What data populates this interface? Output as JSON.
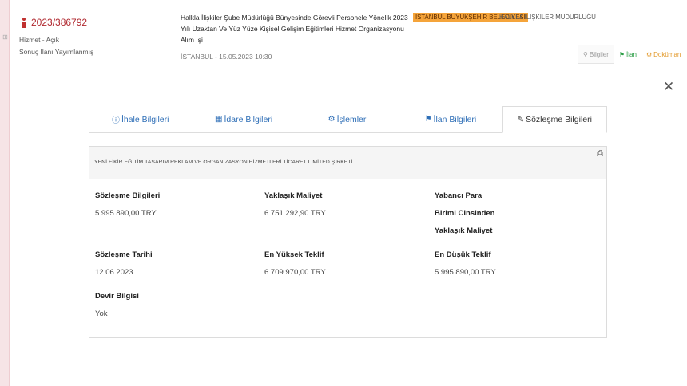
{
  "tender": {
    "number": "2023/386792",
    "status_type": "Hizmet - Açık",
    "status_result": "Sonuç İlanı Yayımlanmış",
    "title": "Halkla İlişkiler Şube Müdürlüğü Bünyesinde Görevli Personele Yönelik 2023 Yılı Uzaktan Ve Yüz Yüze Kişisel Gelişim Eğitimleri Hizmet Organizasyonu Alım İşi",
    "institution": "İSTANBUL BÜYÜKŞEHİR BELEDİYESİ",
    "department": "HALKLA İLİŞKİLER MÜDÜRLÜĞÜ",
    "place_date": "İSTANBUL - 15.05.2023 10:30"
  },
  "top_links": {
    "info": "Bilgiler",
    "announcement": "İlan",
    "document": "Doküman"
  },
  "tabs": [
    {
      "label": "İhale Bilgileri",
      "icon": "info-icon"
    },
    {
      "label": "İdare Bilgileri",
      "icon": "building-icon"
    },
    {
      "label": "İşlemler",
      "icon": "cogs-icon"
    },
    {
      "label": "İlan Bilgileri",
      "icon": "bullhorn-icon"
    },
    {
      "label": "Sözleşme Bilgileri",
      "icon": "edit-icon",
      "active": true
    }
  ],
  "contract": {
    "company": "YENİ FİKİR EĞİTİM TASARIM REKLAM VE ORGANİZASYON HİZMETLERİ TİCARET LİMİTED ŞİRKETİ",
    "contract_info_label": "Sözleşme Bilgileri",
    "contract_info_value": "5.995.890,00 TRY",
    "approx_cost_label": "Yaklaşık Maliyet",
    "approx_cost_value": "6.751.292,90 TRY",
    "foreign_label_1": "Yabancı Para",
    "foreign_label_2": "Birimi Cinsinden",
    "foreign_label_3": "Yaklaşık Maliyet",
    "contract_date_label": "Sözleşme Tarihi",
    "contract_date_value": "12.06.2023",
    "highest_bid_label": "En Yüksek Teklif",
    "highest_bid_value": "6.709.970,00 TRY",
    "lowest_bid_label": "En Düşük Teklif",
    "lowest_bid_value": "5.995.890,00 TRY",
    "transfer_label": "Devir Bilgisi",
    "transfer_value": "Yok"
  },
  "colors": {
    "tender_red": "#b0282f",
    "link_blue": "#2f6fb7",
    "badge_orange": "#f5a43a",
    "announce_green": "#2a9d45",
    "doc_orange": "#e39a2b"
  }
}
